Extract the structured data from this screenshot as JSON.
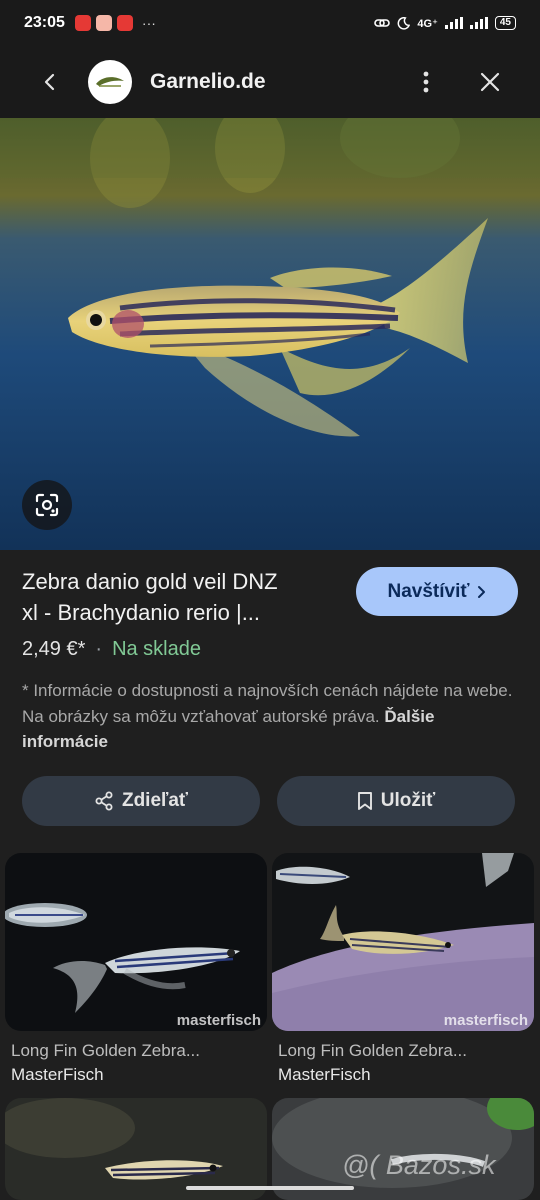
{
  "status_bar": {
    "time": "23:05",
    "more": "···",
    "network": "4G⁺",
    "battery": "45"
  },
  "header": {
    "site_name": "Garnelio.de"
  },
  "product": {
    "title_line1": "Zebra danio gold veil DNZ",
    "title_line2": "xl - Brachydanio rerio |...",
    "visit_label": "Navštíviť",
    "price": "2,49 €*",
    "separator": "·",
    "stock": "Na sklade",
    "disclaimer": "* Informácie o dostupnosti a najnovších cenách nájdete na webe. Na obrázky sa môžu vzťahovať autorské práva.",
    "more_info": "Ďalšie informácie"
  },
  "actions": {
    "share_label": "Zdieľať",
    "save_label": "Uložiť"
  },
  "related": [
    {
      "title": "Long Fin Golden Zebra...",
      "source": "MasterFisch",
      "watermark": "masterfisch"
    },
    {
      "title": "Long Fin Golden Zebra...",
      "source": "MasterFisch",
      "watermark": "masterfisch"
    }
  ],
  "overlay": {
    "watermark": "@( Bazos.sk"
  },
  "colors": {
    "accent_button": "#a8c7fa",
    "in_stock": "#81c995",
    "background": "#1f1f1f"
  }
}
